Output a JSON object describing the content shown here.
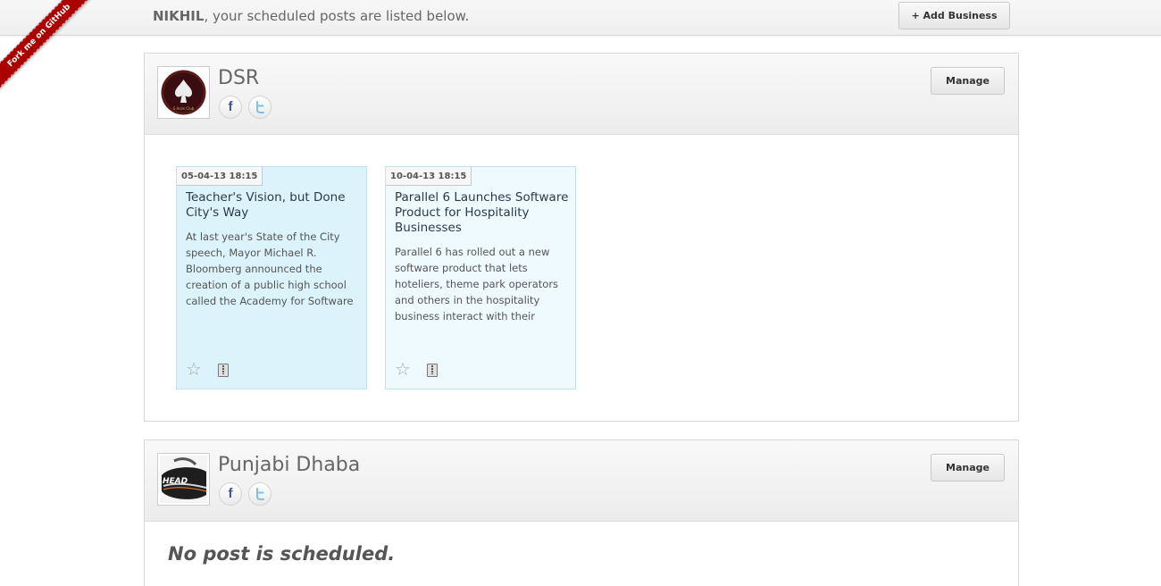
{
  "ribbon": {
    "label": "Fork me on GitHub"
  },
  "header": {
    "user": "NIKHIL",
    "message": ", your scheduled posts are listed below.",
    "add_business_label": "+ Add Business"
  },
  "businesses": [
    {
      "name": "DSR",
      "logo_caption": "S Aces Club",
      "manage_label": "Manage",
      "social": {
        "facebook": "f",
        "twitter": "t"
      },
      "posts": [
        {
          "date": "05-04-13 18:15",
          "title": "Teacher's Vision, but Done City's Way",
          "excerpt": "At last year's State of the City speech, Mayor Michael R. Bloomberg announced the creation of a public high school called the Academy for Software"
        },
        {
          "date": "10-04-13 18:15",
          "title": "Parallel 6 Launches Software Product for Hospitality Businesses",
          "excerpt": "Parallel 6 has rolled out a new software product that lets hoteliers, theme park operators and others in the hospitality business interact with their"
        }
      ]
    },
    {
      "name": "Punjabi Dhaba",
      "logo_caption": "HEAD",
      "manage_label": "Manage",
      "social": {
        "facebook": "f",
        "twitter": "t"
      },
      "empty_message": "No post is scheduled."
    }
  ],
  "icons": {
    "star": "☆",
    "colors": {
      "ribbon": "#aa0000",
      "facebook": "#3b5998",
      "twitter": "#6fb7e6",
      "card_active": "#dcf3fc",
      "card": "#eefaff"
    }
  }
}
